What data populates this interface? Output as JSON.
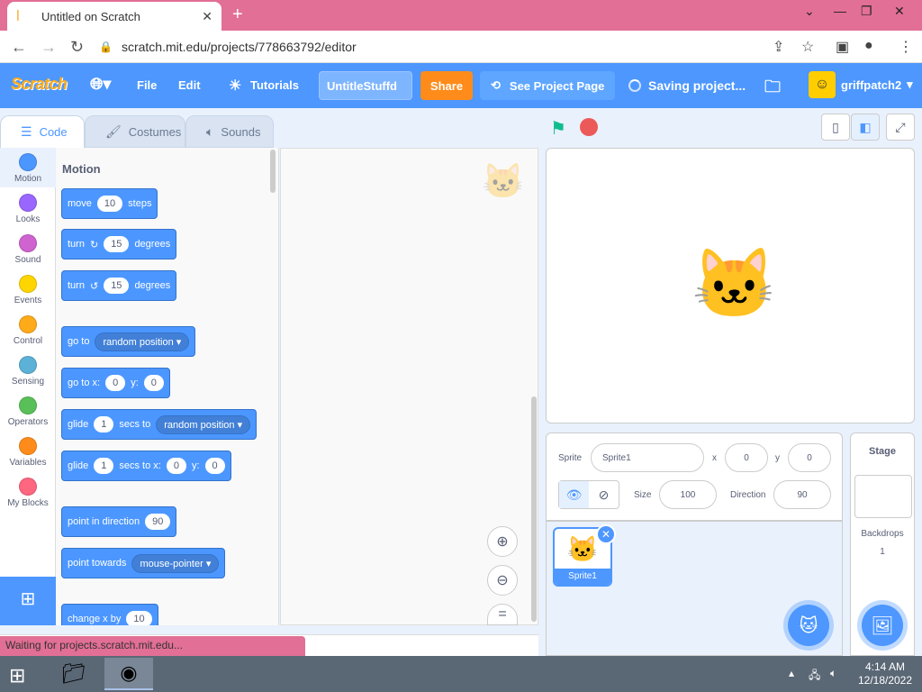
{
  "browser": {
    "tab_title": "Untitled on Scratch",
    "new_tab": "+",
    "url": "scratch.mit.edu/projects/778663792/editor"
  },
  "menubar": {
    "logo": "Scratch",
    "file": "File",
    "edit": "Edit",
    "tutorials": "Tutorials",
    "project_title": "UntitleStuffd",
    "share": "Share",
    "see_project": "See Project Page",
    "saving": "Saving project...",
    "username": "griffpatch2"
  },
  "editor_tabs": [
    "Code",
    "Costumes",
    "Sounds"
  ],
  "categories": [
    {
      "label": "Motion",
      "color": "#4c97ff"
    },
    {
      "label": "Looks",
      "color": "#9966ff"
    },
    {
      "label": "Sound",
      "color": "#cf63cf"
    },
    {
      "label": "Events",
      "color": "#ffd500"
    },
    {
      "label": "Control",
      "color": "#ffab19"
    },
    {
      "label": "Sensing",
      "color": "#5cb1d6"
    },
    {
      "label": "Operators",
      "color": "#59c059"
    },
    {
      "label": "Variables",
      "color": "#ff8c1a"
    },
    {
      "label": "My Blocks",
      "color": "#ff6680"
    }
  ],
  "palette": {
    "title": "Motion",
    "move": {
      "a": "move",
      "v": "10",
      "b": "steps"
    },
    "turn_right": {
      "a": "turn",
      "v": "15",
      "b": "degrees"
    },
    "turn_left": {
      "a": "turn",
      "v": "15",
      "b": "degrees"
    },
    "goto": {
      "a": "go to",
      "dd": "random position"
    },
    "gotoxy": {
      "a": "go to x:",
      "x": "0",
      "b": "y:",
      "y": "0"
    },
    "glide1": {
      "a": "glide",
      "v": "1",
      "b": "secs to",
      "dd": "random position"
    },
    "glide2": {
      "a": "glide",
      "v": "1",
      "b": "secs to x:",
      "x": "0",
      "c": "y:",
      "y": "0"
    },
    "point_dir": {
      "a": "point in direction",
      "v": "90"
    },
    "point_towards": {
      "a": "point towards",
      "dd": "mouse-pointer"
    },
    "change_x": {
      "a": "change x by",
      "v": "10"
    }
  },
  "sprite_info": {
    "sprite_label": "Sprite",
    "sprite_name": "Sprite1",
    "x_label": "x",
    "x": "0",
    "y_label": "y",
    "y": "0",
    "size_label": "Size",
    "size": "100",
    "direction_label": "Direction",
    "direction": "90"
  },
  "sprite_list": [
    {
      "name": "Sprite1"
    }
  ],
  "stage_panel": {
    "title": "Stage",
    "backdrops_label": "Backdrops",
    "backdrops_count": "1"
  },
  "status_text": "Waiting for projects.scratch.mit.edu...",
  "taskbar": {
    "time": "4:14 AM",
    "date": "12/18/2022"
  }
}
